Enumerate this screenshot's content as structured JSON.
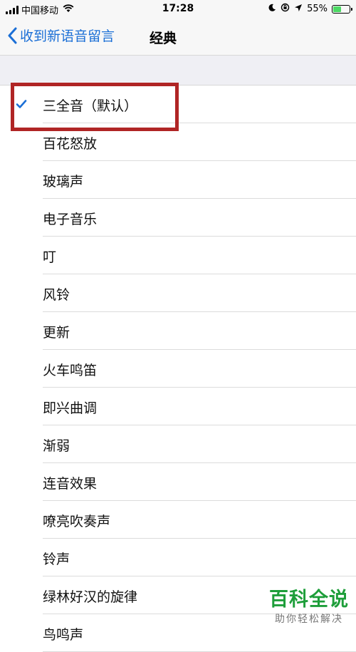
{
  "status_bar": {
    "carrier": "中国移动",
    "time": "17:28",
    "battery_percent": "55%",
    "battery_level": 0.55,
    "icons": [
      "signal-icon",
      "wifi-icon",
      "moon-icon",
      "rotation-lock-icon",
      "location-icon",
      "battery-icon"
    ]
  },
  "nav": {
    "back_label": "收到新语音留言",
    "title": "经典"
  },
  "tones": {
    "selected_index": 0,
    "items": [
      {
        "label": "三全音（默认）"
      },
      {
        "label": "百花怒放"
      },
      {
        "label": "玻璃声"
      },
      {
        "label": "电子音乐"
      },
      {
        "label": "叮"
      },
      {
        "label": "风铃"
      },
      {
        "label": "更新"
      },
      {
        "label": "火车鸣笛"
      },
      {
        "label": "即兴曲调"
      },
      {
        "label": "渐弱"
      },
      {
        "label": "连音效果"
      },
      {
        "label": "嘹亮吹奏声"
      },
      {
        "label": "铃声"
      },
      {
        "label": "绿林好汉的旋律"
      },
      {
        "label": "鸟鸣声"
      }
    ]
  },
  "colors": {
    "accent": "#1b6fd6",
    "highlight_box": "#b02525",
    "battery_fill": "#4cd964",
    "watermark": "#1e9e3a"
  },
  "watermark": {
    "title": "百科全说",
    "subtitle": "助你轻松解决"
  }
}
